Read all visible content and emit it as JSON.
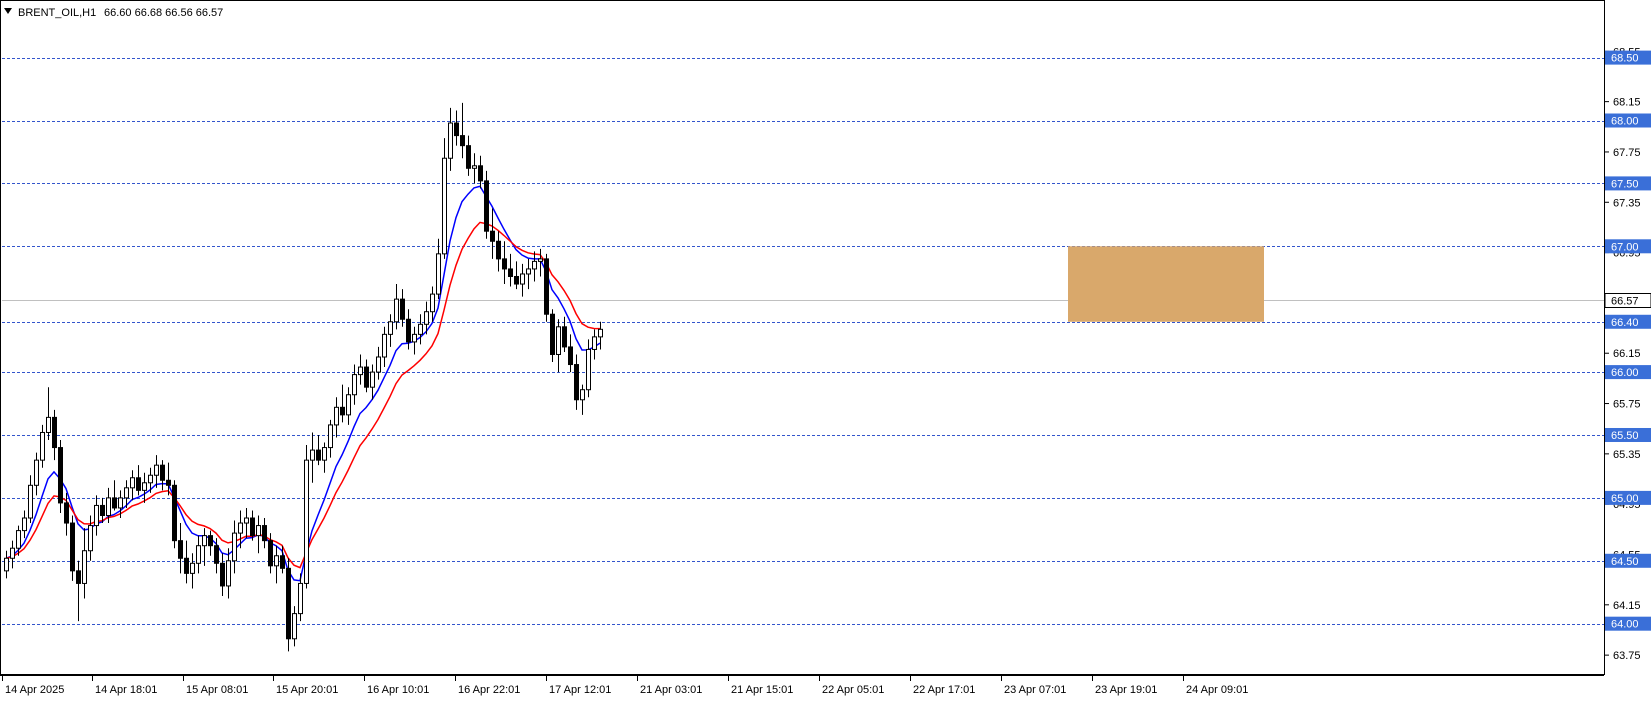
{
  "header": {
    "symbol_label": "BRENT_OIL,H1",
    "ohlc_text": "66.60 66.68 66.56 66.57",
    "menu_icon": "triangle-down-icon"
  },
  "colors": {
    "background": "#ffffff",
    "candle_up_fill": "#ffffff",
    "candle_down_fill": "#000000",
    "candle_outline": "#000000",
    "fast_ma": "#0000ff",
    "slow_ma": "#ff0000",
    "level_line": "#3355cc",
    "level_label_bg": "#3a6fd8",
    "level_label_text": "#ffffff",
    "price_label_bg": "#ffffff",
    "zone_fill": "#d9a86b",
    "current_price_line": "#c0c0c0"
  },
  "chart_data": {
    "type": "candlestick",
    "symbol": "BRENT_OIL",
    "timeframe": "H1",
    "ylim": [
      63.6,
      68.95
    ],
    "y_ticks": [
      "68.55",
      "68.15",
      "67.75",
      "67.35",
      "66.95",
      "66.55",
      "66.15",
      "65.75",
      "65.35",
      "64.95",
      "64.55",
      "64.15",
      "63.75"
    ],
    "x_ticks": [
      "14 Apr 2025",
      "14 Apr 18:01",
      "15 Apr 08:01",
      "15 Apr 20:01",
      "16 Apr 10:01",
      "16 Apr 22:01",
      "17 Apr 12:01",
      "21 Apr 03:01",
      "21 Apr 15:01",
      "22 Apr 05:01",
      "22 Apr 17:01",
      "23 Apr 07:01",
      "23 Apr 19:01",
      "24 Apr 09:01"
    ],
    "current_price": "66.57",
    "horizontal_levels": [
      "68.50",
      "68.00",
      "67.50",
      "67.00",
      "66.40",
      "66.00",
      "65.50",
      "65.00",
      "64.50",
      "64.00"
    ],
    "zone": {
      "top": 67.0,
      "bottom": 66.4
    },
    "candles": [
      [
        64.42,
        64.58,
        64.36,
        64.52
      ],
      [
        64.52,
        64.66,
        64.44,
        64.6
      ],
      [
        64.6,
        64.78,
        64.54,
        64.74
      ],
      [
        64.74,
        64.9,
        64.68,
        64.84
      ],
      [
        64.84,
        65.18,
        64.8,
        65.1
      ],
      [
        65.1,
        65.36,
        65.02,
        65.3
      ],
      [
        65.3,
        65.58,
        65.24,
        65.52
      ],
      [
        65.52,
        65.88,
        65.46,
        65.64
      ],
      [
        65.64,
        65.7,
        65.3,
        65.4
      ],
      [
        65.4,
        65.46,
        64.88,
        64.96
      ],
      [
        64.96,
        65.04,
        64.7,
        64.8
      ],
      [
        64.8,
        64.86,
        64.34,
        64.42
      ],
      [
        64.42,
        64.5,
        64.02,
        64.32
      ],
      [
        64.32,
        64.76,
        64.2,
        64.58
      ],
      [
        64.58,
        64.86,
        64.5,
        64.78
      ],
      [
        64.78,
        65.02,
        64.7,
        64.94
      ],
      [
        64.94,
        65.0,
        64.8,
        64.86
      ],
      [
        64.86,
        65.08,
        64.8,
        65.0
      ],
      [
        65.0,
        65.14,
        64.9,
        64.92
      ],
      [
        64.92,
        65.06,
        64.84,
        65.0
      ],
      [
        65.0,
        65.14,
        64.92,
        65.08
      ],
      [
        65.08,
        65.22,
        64.98,
        65.16
      ],
      [
        65.16,
        65.26,
        65.02,
        65.06
      ],
      [
        65.06,
        65.2,
        64.96,
        65.12
      ],
      [
        65.12,
        65.24,
        65.04,
        65.18
      ],
      [
        65.18,
        65.34,
        65.08,
        65.26
      ],
      [
        65.26,
        65.3,
        65.06,
        65.14
      ],
      [
        65.14,
        65.28,
        65.02,
        65.1
      ],
      [
        65.1,
        65.14,
        64.6,
        64.66
      ],
      [
        64.66,
        64.8,
        64.4,
        64.52
      ],
      [
        64.52,
        64.66,
        64.32,
        64.4
      ],
      [
        64.4,
        64.56,
        64.28,
        64.48
      ],
      [
        64.48,
        64.7,
        64.4,
        64.62
      ],
      [
        64.62,
        64.76,
        64.46,
        64.7
      ],
      [
        64.7,
        64.74,
        64.54,
        64.62
      ],
      [
        64.62,
        64.68,
        64.4,
        64.48
      ],
      [
        64.48,
        64.56,
        64.22,
        64.3
      ],
      [
        64.3,
        64.6,
        64.2,
        64.5
      ],
      [
        64.5,
        64.82,
        64.4,
        64.72
      ],
      [
        64.72,
        64.9,
        64.6,
        64.8
      ],
      [
        64.8,
        64.92,
        64.68,
        64.84
      ],
      [
        64.84,
        64.9,
        64.66,
        64.7
      ],
      [
        64.7,
        64.86,
        64.56,
        64.78
      ],
      [
        64.78,
        64.84,
        64.6,
        64.66
      ],
      [
        64.66,
        64.72,
        64.4,
        64.46
      ],
      [
        64.46,
        64.62,
        64.32,
        64.54
      ],
      [
        64.54,
        64.62,
        64.4,
        64.44
      ],
      [
        64.44,
        64.52,
        63.78,
        63.88
      ],
      [
        63.88,
        64.14,
        63.82,
        64.08
      ],
      [
        64.08,
        64.4,
        64.02,
        64.32
      ],
      [
        64.32,
        65.42,
        64.28,
        65.3
      ],
      [
        65.3,
        65.52,
        65.12,
        65.38
      ],
      [
        65.38,
        65.5,
        65.26,
        65.3
      ],
      [
        65.3,
        65.44,
        65.2,
        65.4
      ],
      [
        65.4,
        65.62,
        65.32,
        65.58
      ],
      [
        65.58,
        65.8,
        65.48,
        65.72
      ],
      [
        65.72,
        65.9,
        65.6,
        65.66
      ],
      [
        65.66,
        65.88,
        65.58,
        65.82
      ],
      [
        65.82,
        66.06,
        65.74,
        65.98
      ],
      [
        65.98,
        66.14,
        65.9,
        66.04
      ],
      [
        66.04,
        66.1,
        65.84,
        65.88
      ],
      [
        65.88,
        66.06,
        65.78,
        66.0
      ],
      [
        66.0,
        66.2,
        65.94,
        66.12
      ],
      [
        66.12,
        66.36,
        66.04,
        66.3
      ],
      [
        66.3,
        66.46,
        66.2,
        66.4
      ],
      [
        66.4,
        66.7,
        66.34,
        66.58
      ],
      [
        66.58,
        66.66,
        66.36,
        66.42
      ],
      [
        66.42,
        66.5,
        66.18,
        66.24
      ],
      [
        66.24,
        66.36,
        66.14,
        66.3
      ],
      [
        66.3,
        66.46,
        66.22,
        66.38
      ],
      [
        66.38,
        66.56,
        66.3,
        66.48
      ],
      [
        66.48,
        66.68,
        66.4,
        66.62
      ],
      [
        66.62,
        67.06,
        66.58,
        66.94
      ],
      [
        66.94,
        67.86,
        66.9,
        67.7
      ],
      [
        67.7,
        68.1,
        67.6,
        67.98
      ],
      [
        67.98,
        68.08,
        67.8,
        67.88
      ],
      [
        67.88,
        68.14,
        67.7,
        67.8
      ],
      [
        67.8,
        67.88,
        67.56,
        67.62
      ],
      [
        67.62,
        67.74,
        67.5,
        67.64
      ],
      [
        67.64,
        67.72,
        67.46,
        67.52
      ],
      [
        67.52,
        67.6,
        67.06,
        67.12
      ],
      [
        67.12,
        67.3,
        66.9,
        67.04
      ],
      [
        67.04,
        67.12,
        66.8,
        66.9
      ],
      [
        66.9,
        67.04,
        66.7,
        66.82
      ],
      [
        66.82,
        66.94,
        66.68,
        66.76
      ],
      [
        66.76,
        66.88,
        66.66,
        66.7
      ],
      [
        66.7,
        66.86,
        66.6,
        66.78
      ],
      [
        66.78,
        66.9,
        66.66,
        66.82
      ],
      [
        66.82,
        66.96,
        66.72,
        66.88
      ],
      [
        66.88,
        66.98,
        66.76,
        66.9
      ],
      [
        66.9,
        66.94,
        66.4,
        66.46
      ],
      [
        66.46,
        66.5,
        66.08,
        66.14
      ],
      [
        66.14,
        66.42,
        66.0,
        66.36
      ],
      [
        66.36,
        66.44,
        66.16,
        66.2
      ],
      [
        66.2,
        66.3,
        66.0,
        66.06
      ],
      [
        66.06,
        66.14,
        65.7,
        65.78
      ],
      [
        65.78,
        65.9,
        65.66,
        65.86
      ],
      [
        65.86,
        66.26,
        65.8,
        66.18
      ],
      [
        66.18,
        66.34,
        66.1,
        66.28
      ],
      [
        66.28,
        66.4,
        66.18,
        66.34
      ]
    ]
  }
}
